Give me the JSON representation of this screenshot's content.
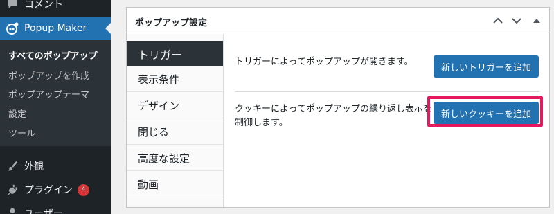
{
  "sidebar": {
    "comments_label": "コメント",
    "popup_maker_label": "Popup Maker",
    "submenu": [
      {
        "label": "すべてのポップアップ"
      },
      {
        "label": "ポップアップを作成"
      },
      {
        "label": "ポップアップテーマ"
      },
      {
        "label": "設定"
      },
      {
        "label": "ツール"
      }
    ],
    "appearance_label": "外観",
    "plugins_label": "プラグイン",
    "plugins_badge": "4",
    "users_label": "ユーザー"
  },
  "panel": {
    "title": "ポップアップ設定",
    "tabs": [
      {
        "label": "トリガー"
      },
      {
        "label": "表示条件"
      },
      {
        "label": "デザイン"
      },
      {
        "label": "閉じる"
      },
      {
        "label": "高度な設定"
      },
      {
        "label": "動画"
      }
    ],
    "triggers": {
      "description": "トリガーによってポップアップが開きます。",
      "add_button": "新しいトリガーを追加"
    },
    "cookies": {
      "description_line1": "クッキーによってポップアップの繰り返し表示を",
      "description_line2": "制御します。",
      "add_button": "新しいクッキーを追加"
    }
  },
  "colors": {
    "admin_menu": "#1d2327",
    "accent_blue": "#2271b1",
    "highlight": "#e6185e"
  }
}
